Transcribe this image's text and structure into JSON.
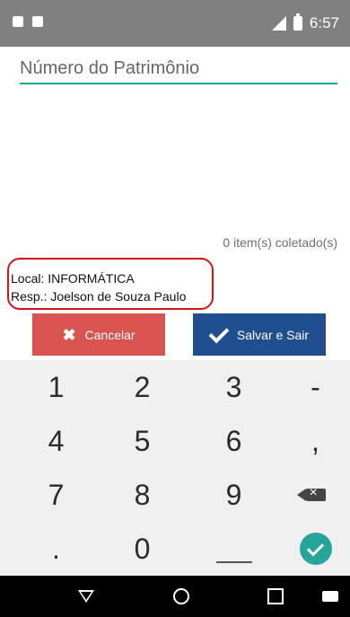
{
  "status_bar": {
    "time": "6:57",
    "left_icons": [
      "notification-icon",
      "android-icon"
    ],
    "right_icons": [
      "signal-icon",
      "battery-icon"
    ]
  },
  "form": {
    "patrimonio_placeholder": "Número do Patrimônio",
    "patrimonio_value": ""
  },
  "collected_count": "0 item(s) coletado(s)",
  "info": {
    "local_label": "Local:",
    "local_value": "INFORMÁTICA",
    "resp_label": "Resp.:",
    "resp_value": "Joelson de Souza Paulo"
  },
  "buttons": {
    "cancel_label": "Cancelar",
    "save_label": "Salvar e Sair"
  },
  "keyboard": {
    "keys": [
      "1",
      "2",
      "3",
      "-",
      "4",
      "5",
      "6",
      ",",
      "7",
      "8",
      "9",
      ".",
      "0"
    ]
  },
  "colors": {
    "accent": "#1aa79b",
    "cancel": "#d9534f",
    "save": "#1f4f8f",
    "highlight": "#d6131a"
  }
}
